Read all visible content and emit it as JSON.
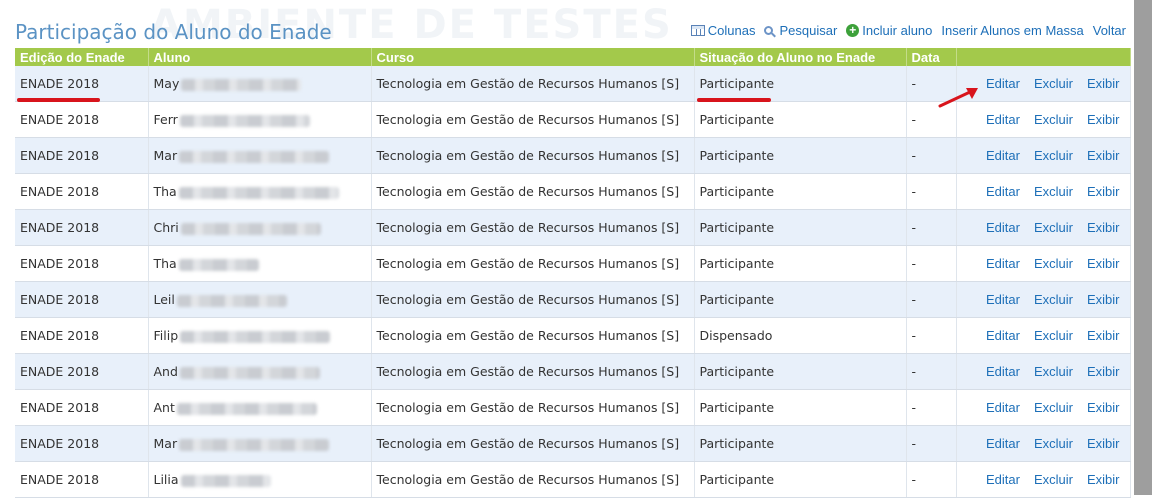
{
  "page": {
    "title": "Participação do Aluno do Enade",
    "watermark": "AMBIENTE DE TESTES"
  },
  "toolbar": {
    "columns": "Colunas",
    "search": "Pesquisar",
    "add_student": "Incluir aluno",
    "bulk_insert": "Inserir Alunos em Massa",
    "back": "Voltar"
  },
  "table": {
    "headers": [
      "Edição do Enade",
      "Aluno",
      "Curso",
      "Situação do Aluno no Enade",
      "Data",
      ""
    ],
    "action_labels": {
      "edit": "Editar",
      "delete": "Excluir",
      "view": "Exibir"
    },
    "rows": [
      {
        "edicao": "ENADE 2018",
        "aluno": "May",
        "curso": "Tecnologia em Gestão de Recursos Humanos [S]",
        "situacao": "Participante",
        "data": "-"
      },
      {
        "edicao": "ENADE 2018",
        "aluno": "Ferr",
        "curso": "Tecnologia em Gestão de Recursos Humanos [S]",
        "situacao": "Participante",
        "data": "-"
      },
      {
        "edicao": "ENADE 2018",
        "aluno": "Mar",
        "curso": "Tecnologia em Gestão de Recursos Humanos [S]",
        "situacao": "Participante",
        "data": "-"
      },
      {
        "edicao": "ENADE 2018",
        "aluno": "Tha",
        "curso": "Tecnologia em Gestão de Recursos Humanos [S]",
        "situacao": "Participante",
        "data": "-"
      },
      {
        "edicao": "ENADE 2018",
        "aluno": "Chri",
        "curso": "Tecnologia em Gestão de Recursos Humanos [S]",
        "situacao": "Participante",
        "data": "-"
      },
      {
        "edicao": "ENADE 2018",
        "aluno": "Tha",
        "curso": "Tecnologia em Gestão de Recursos Humanos [S]",
        "situacao": "Participante",
        "data": "-"
      },
      {
        "edicao": "ENADE 2018",
        "aluno": "Leil",
        "curso": "Tecnologia em Gestão de Recursos Humanos [S]",
        "situacao": "Participante",
        "data": "-"
      },
      {
        "edicao": "ENADE 2018",
        "aluno": "Filip",
        "curso": "Tecnologia em Gestão de Recursos Humanos [S]",
        "situacao": "Dispensado",
        "data": "-"
      },
      {
        "edicao": "ENADE 2018",
        "aluno": "And",
        "curso": "Tecnologia em Gestão de Recursos Humanos [S]",
        "situacao": "Participante",
        "data": "-"
      },
      {
        "edicao": "ENADE 2018",
        "aluno": "Ant",
        "curso": "Tecnologia em Gestão de Recursos Humanos [S]",
        "situacao": "Participante",
        "data": "-"
      },
      {
        "edicao": "ENADE 2018",
        "aluno": "Mar",
        "curso": "Tecnologia em Gestão de Recursos Humanos [S]",
        "situacao": "Participante",
        "data": "-"
      },
      {
        "edicao": "ENADE 2018",
        "aluno": "Lilia",
        "curso": "Tecnologia em Gestão de Recursos Humanos [S]",
        "situacao": "Participante",
        "data": "-"
      }
    ]
  },
  "colors": {
    "header_bg": "#a3c94b",
    "row_alt_bg": "#e8f0fa",
    "link": "#1d6fb8",
    "title": "#5b93c4",
    "annotation_red": "#d8141c"
  }
}
